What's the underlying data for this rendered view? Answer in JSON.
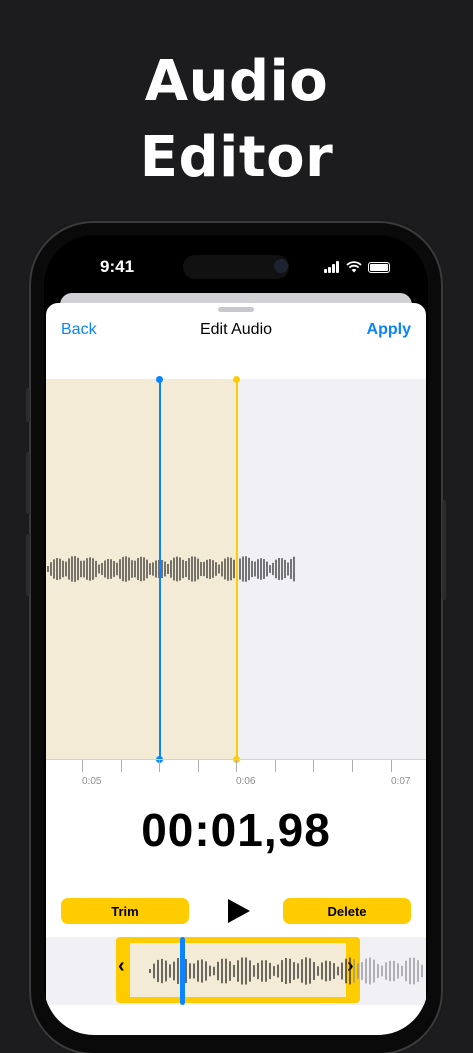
{
  "headline": {
    "line1": "Audio",
    "line2": "Editor"
  },
  "status_bar": {
    "time": "9:41",
    "icons": [
      "signal-icon",
      "wifi-icon",
      "battery-icon"
    ]
  },
  "nav": {
    "back_label": "Back",
    "title": "Edit Audio",
    "apply_label": "Apply"
  },
  "timeline": {
    "ticks": [
      "0:05",
      "0:06",
      "0:07"
    ]
  },
  "current_time": "00:01,98",
  "controls": {
    "trim_label": "Trim",
    "delete_label": "Delete",
    "play_icon": "play-icon"
  },
  "colors": {
    "accent_blue": "#0a84ff",
    "accent_yellow": "#ffcc00",
    "selection": "#f3ebd5"
  }
}
